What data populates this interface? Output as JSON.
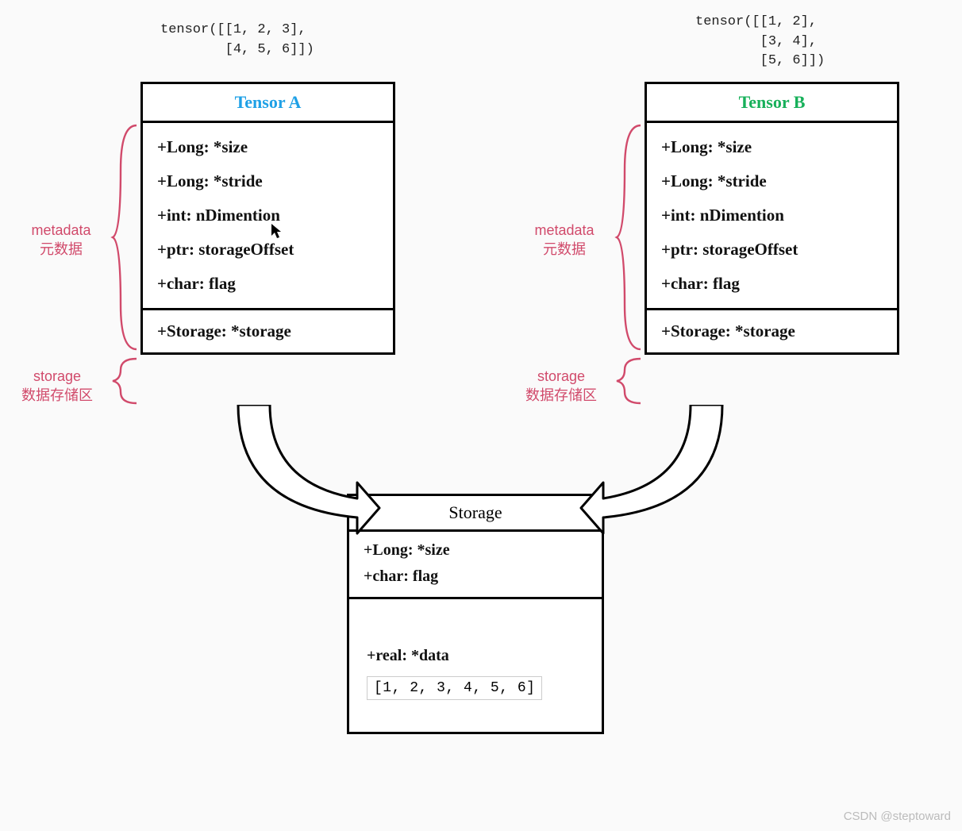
{
  "code_a": "tensor([[1, 2, 3],\n        [4, 5, 6]])",
  "code_b": "tensor([[1, 2],\n        [3, 4],\n        [5, 6]])",
  "tensor_a": {
    "title": "Tensor A",
    "fields": {
      "size": "+Long: *size",
      "stride": "+Long: *stride",
      "ndim": "+int: nDimention",
      "offset": "+ptr: storageOffset",
      "flag": "+char: flag"
    },
    "storage_field": "+Storage: *storage"
  },
  "tensor_b": {
    "title": "Tensor B",
    "fields": {
      "size": "+Long: *size",
      "stride": "+Long: *stride",
      "ndim": "+int: nDimention",
      "offset": "+ptr: storageOffset",
      "flag": "+char: flag"
    },
    "storage_field": "+Storage: *storage"
  },
  "storage": {
    "title": "Storage",
    "size": "+Long: *size",
    "flag": "+char: flag",
    "data_field": "+real: *data",
    "data_values": "[1, 2, 3, 4, 5, 6]"
  },
  "anno": {
    "metadata_line1": "metadata",
    "metadata_line2": "元数据",
    "storage_line1": "storage",
    "storage_line2": "数据存储区"
  },
  "watermark": "CSDN @steptoward",
  "colors": {
    "pink": "#d14a6b",
    "blue": "#1ea0e6",
    "green": "#17b05a"
  }
}
